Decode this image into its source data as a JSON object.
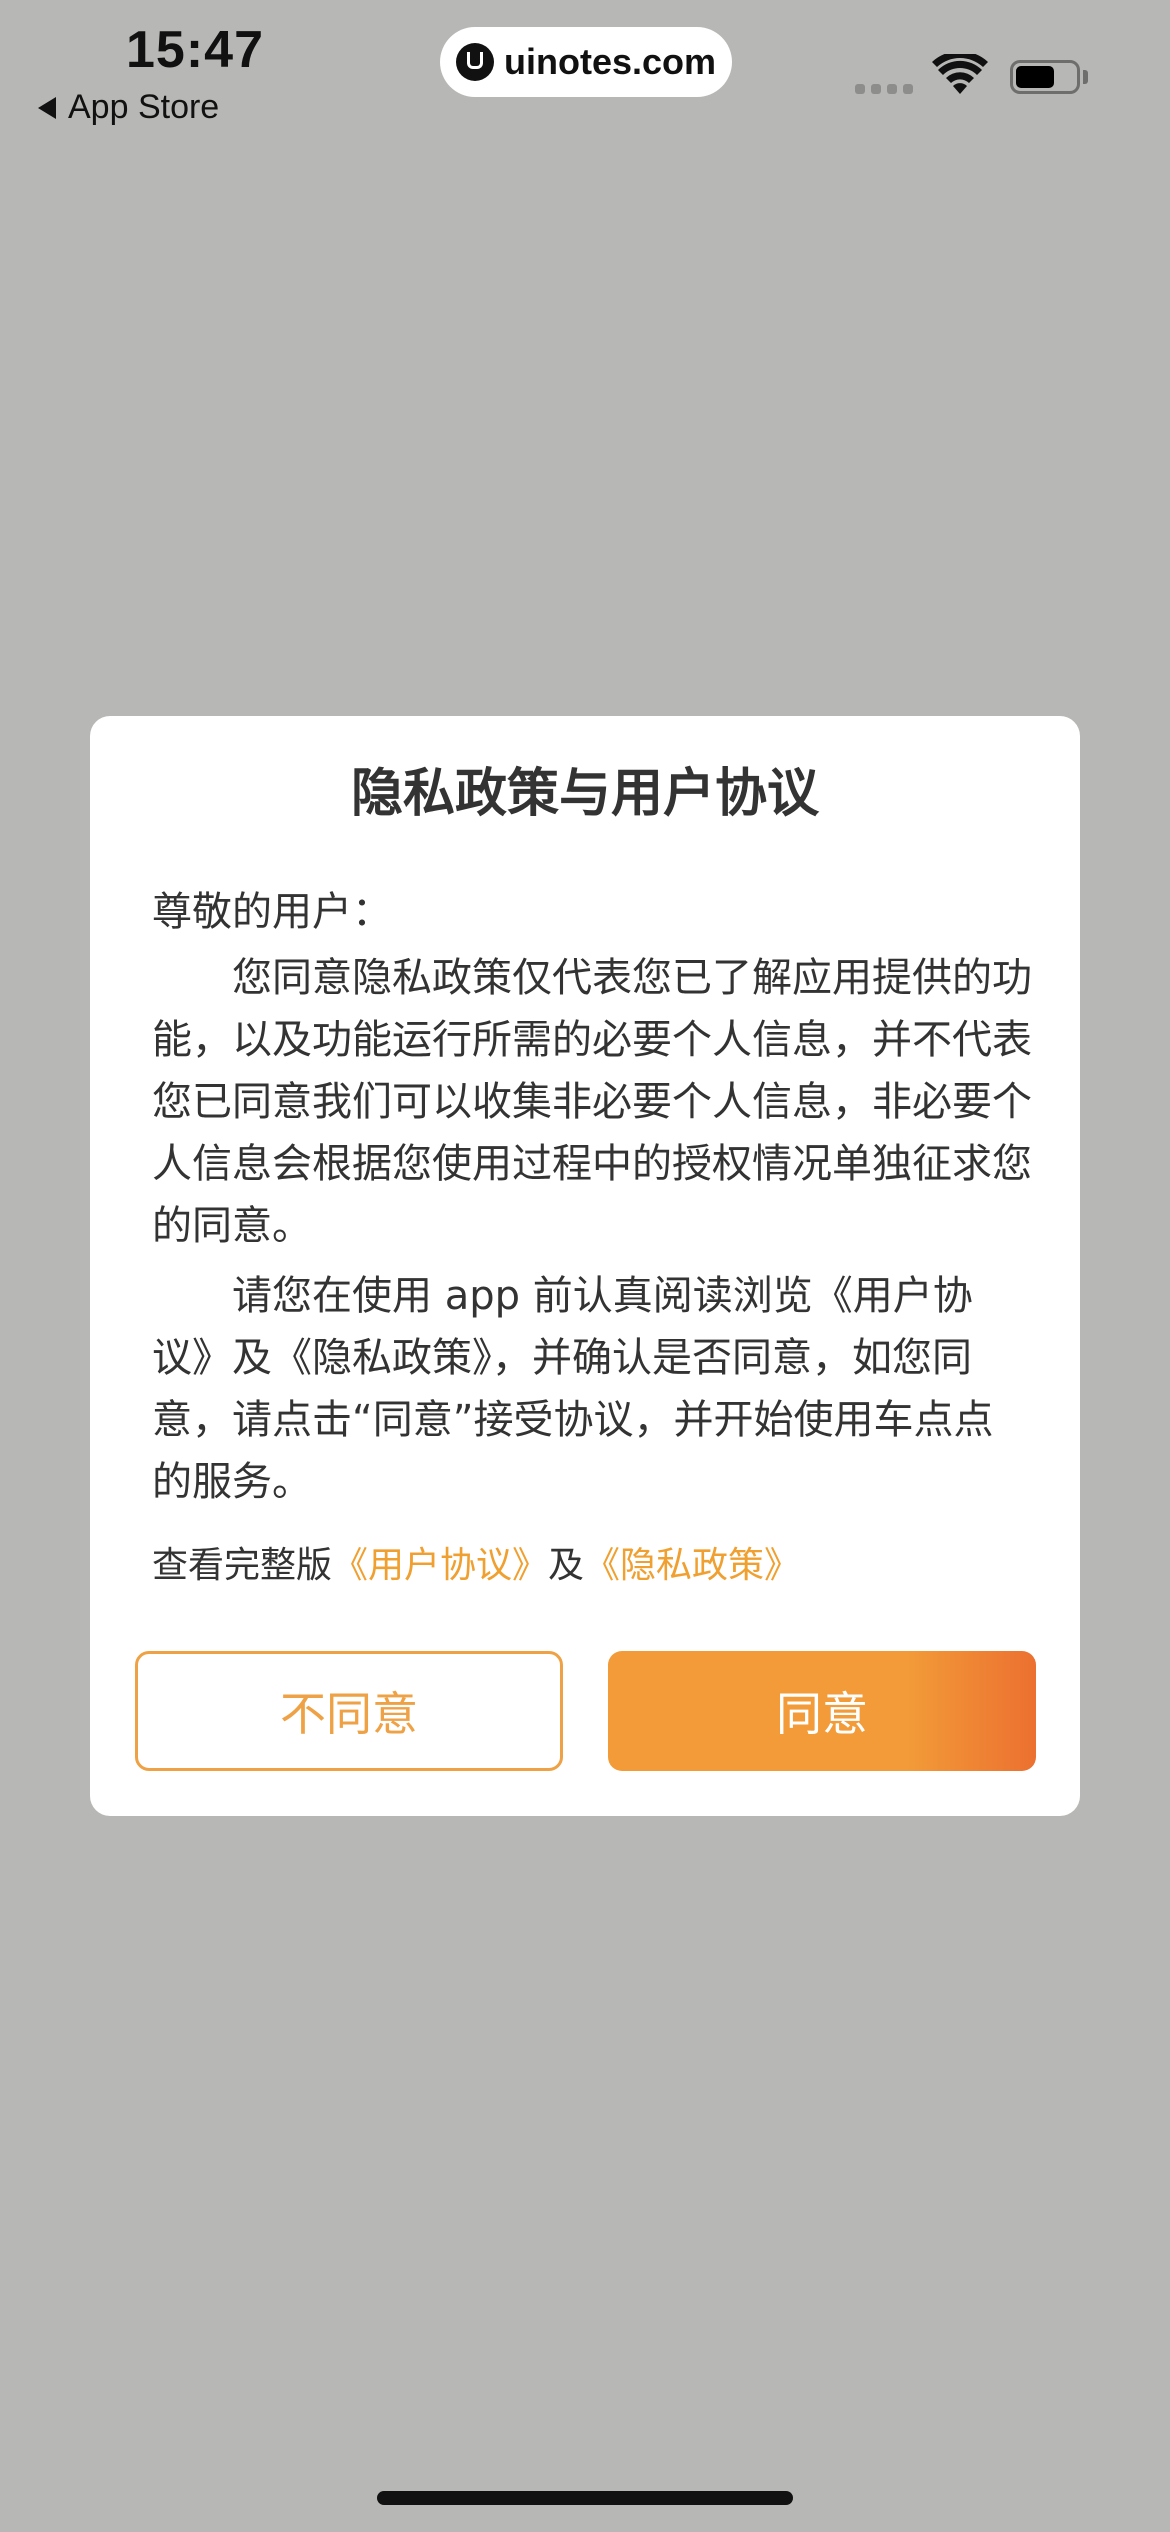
{
  "status_bar": {
    "time": "15:47",
    "back_label": "App Store",
    "url": "uinotes.com",
    "icons": [
      "signal-icon",
      "wifi-icon",
      "battery-icon"
    ]
  },
  "dialog": {
    "title": "隐私政策与用户协议",
    "greeting": "尊敬的用户：",
    "paragraph1": "您同意隐私政策仅代表您已了解应用提供的功能，以及功能运行所需的必要个人信息，并不代表您已同意我们可以收集非必要个人信息，非必要个人信息会根据您使用过程中的授权情况单独征求您的同意。",
    "paragraph2": "请您在使用 app 前认真阅读浏览《用户协议》及《隐私政策》，并确认是否同意，如您同意，请点击“同意”接受协议，并开始使用车点点的服务。",
    "links": {
      "prefix": "查看完整版",
      "user_agreement": "《用户协议》",
      "conjunction": "及",
      "privacy_policy": "《隐私政策》"
    },
    "buttons": {
      "disagree": "不同意",
      "agree": "同意"
    }
  },
  "colors": {
    "backdrop": "#b7b7b5",
    "accent": "#f29b38",
    "accent_end": "#ec7030",
    "link": "#f0a030",
    "text": "#333333"
  }
}
